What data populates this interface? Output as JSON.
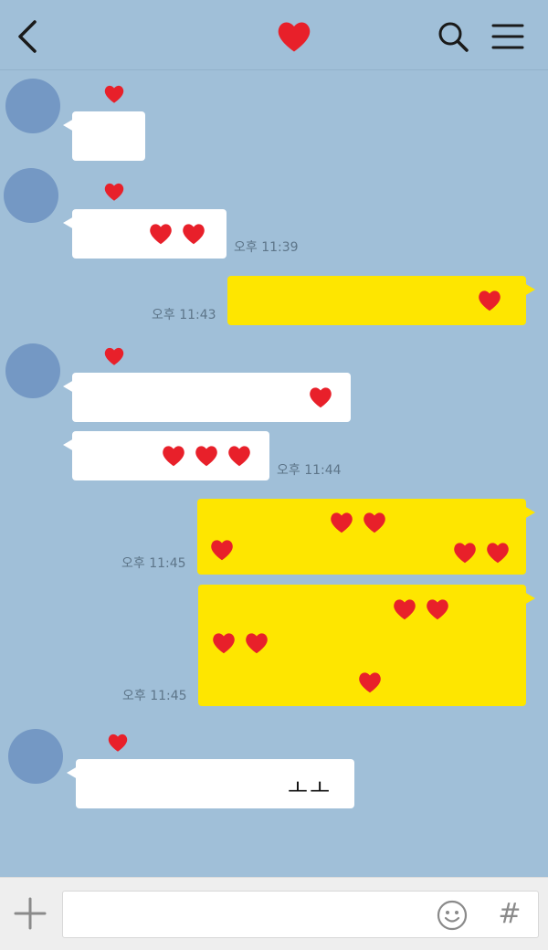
{
  "header": {
    "back_icon": "chevron-left-icon",
    "title_icon": "heart-icon",
    "search_icon": "search-icon",
    "menu_icon": "hamburger-icon"
  },
  "colors": {
    "background": "#a0bfd8",
    "incoming_bubble": "#ffffff",
    "outgoing_bubble": "#fee600",
    "avatar": "#7498c4",
    "heart": "#e8202a"
  },
  "messages": [
    {
      "id": "m1",
      "direction": "in",
      "sender_icon": "heart-icon",
      "hearts": 0,
      "time": ""
    },
    {
      "id": "m2",
      "direction": "in",
      "sender_icon": "heart-icon",
      "hearts": 2,
      "time": "오후 11:39"
    },
    {
      "id": "m3",
      "direction": "out",
      "hearts": 1,
      "time": "오후 11:43"
    },
    {
      "id": "m4",
      "direction": "in",
      "sender_icon": "heart-icon",
      "hearts": 1,
      "time": ""
    },
    {
      "id": "m5",
      "direction": "in",
      "hearts": 3,
      "time": "오후 11:44"
    },
    {
      "id": "m6",
      "direction": "out",
      "hearts": 5,
      "time": "오후 11:45"
    },
    {
      "id": "m7",
      "direction": "out",
      "hearts": 5,
      "time": "오후 11:45"
    },
    {
      "id": "m8",
      "direction": "in",
      "sender_icon": "heart-icon",
      "hearts": 0,
      "text": "ㅗㅗ",
      "time": ""
    }
  ],
  "input_bar": {
    "add_icon": "plus-icon",
    "placeholder": "",
    "emoji_icon": "smiley-icon",
    "hash_label": "#"
  }
}
